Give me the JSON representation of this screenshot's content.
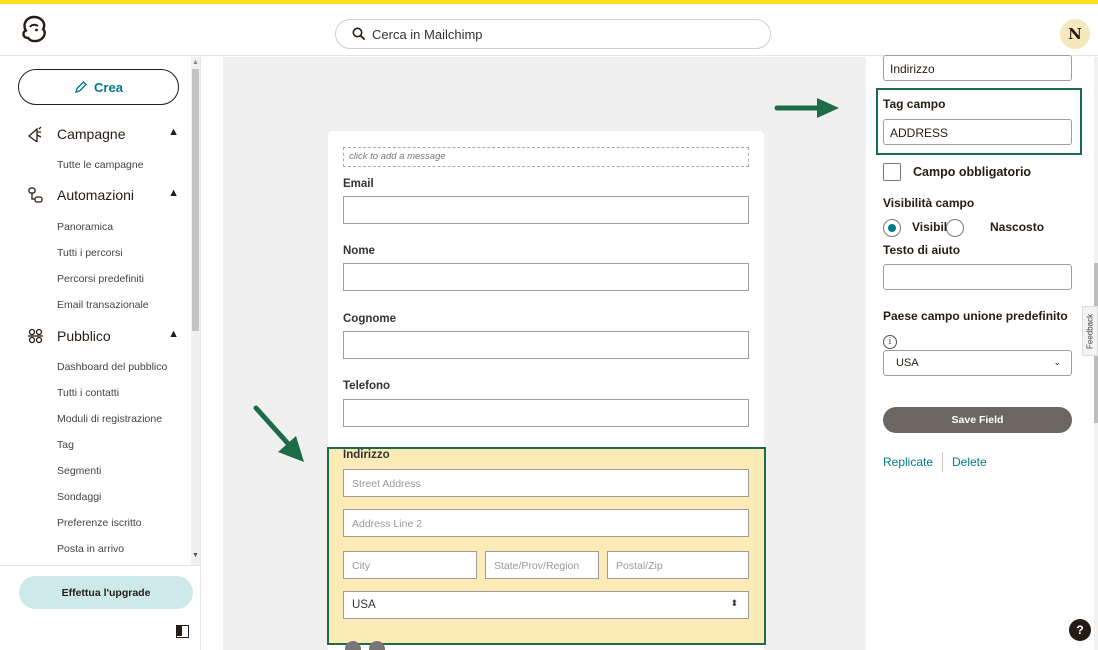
{
  "header": {
    "search_placeholder": "Cerca in Mailchimp",
    "avatar_initial": "N"
  },
  "sidebar": {
    "create_label": "Crea",
    "sections": [
      {
        "label": "Campagne",
        "items": [
          "Tutte le campagne"
        ]
      },
      {
        "label": "Automazioni",
        "items": [
          "Panoramica",
          "Tutti i percorsi",
          "Percorsi predefiniti",
          "Email transazionale"
        ]
      },
      {
        "label": "Pubblico",
        "items": [
          "Dashboard del pubblico",
          "Tutti i contatti",
          "Moduli di registrazione",
          "Tag",
          "Segmenti",
          "Sondaggi",
          "Preferenze iscritto",
          "Posta in arrivo"
        ]
      }
    ],
    "upgrade_label": "Effettua l'upgrade"
  },
  "form": {
    "message_placeholder": "click to add a message",
    "fields": {
      "email": "Email",
      "nome": "Nome",
      "cognome": "Cognome",
      "telefono": "Telefono"
    },
    "address": {
      "label": "Indirizzo",
      "street_placeholder": "Street Address",
      "line2_placeholder": "Address Line 2",
      "city_placeholder": "City",
      "state_placeholder": "State/Prov/Region",
      "zip_placeholder": "Postal/Zip",
      "country_value": "USA"
    }
  },
  "panel": {
    "field_label_value": "Indirizzo",
    "tag_label": "Tag campo",
    "tag_value": "ADDRESS",
    "required_label": "Campo obbligatorio",
    "visibility_label": "Visibilità campo",
    "visible_label": "Visibile",
    "hidden_label": "Nascosto",
    "visibility_selected": "Visibile",
    "help_text_label": "Testo di aiuto",
    "help_text_value": "",
    "default_country_label": "Paese campo unione predefinito",
    "default_country_value": "USA",
    "save_label": "Save Field",
    "replicate_label": "Replicate",
    "delete_label": "Delete",
    "feedback_label": "Feedback",
    "help_label": "?"
  },
  "colors": {
    "accent": "#007c89",
    "highlight_border": "#1e6b48",
    "highlight_fill": "#fcebb7",
    "brand_yellow": "#ffe01b",
    "upgrade_bg": "#cde9ea"
  }
}
